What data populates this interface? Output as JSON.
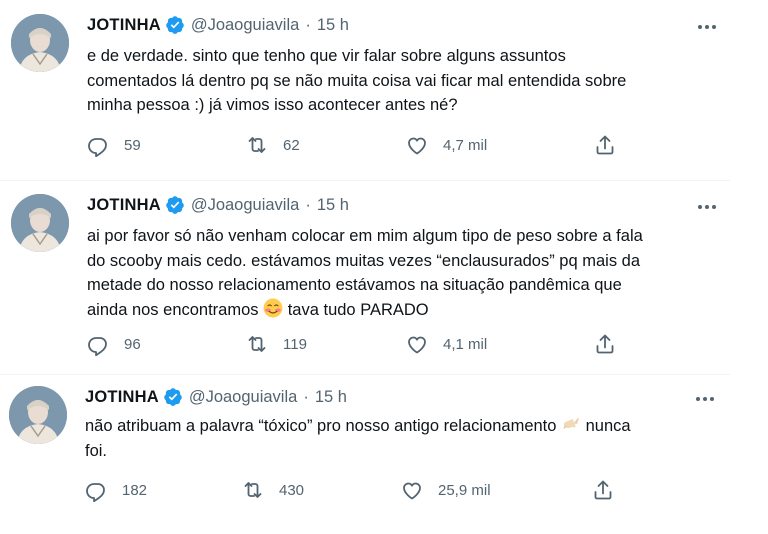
{
  "tweets": [
    {
      "author": {
        "name": "JOTINHA",
        "handle": "@Joaoguiavila",
        "time": "15 h",
        "avatar_icon": "profile-photo"
      },
      "lines": [
        "e de verdade. sinto que tenho que vir falar sobre alguns assuntos",
        "comentados lá dentro pq se não muita coisa vai ficar mal entendida sobre",
        "minha pessoa :) já vimos isso acontecer antes né?"
      ],
      "stats": {
        "replies": "59",
        "retweets": "62",
        "likes": "4,7 mil"
      }
    },
    {
      "author": {
        "name": "JOTINHA",
        "handle": "@Joaoguiavila",
        "time": "15 h",
        "avatar_icon": "profile-photo"
      },
      "lines": [
        "ai por favor só não venham colocar em mim algum tipo de peso sobre a fala",
        "do scooby mais cedo. estávamos muitas vezes “enclausurados” pq mais da",
        "metade do nosso relacionamento estávamos na situação pandêmica que",
        "ainda nos encontramos",
        "tava tudo PARADO"
      ],
      "emoji": "smiling-face-with-blush",
      "stats": {
        "replies": "96",
        "retweets": "119",
        "likes": "4,1 mil"
      }
    },
    {
      "author": {
        "name": "JOTINHA",
        "handle": "@Joaoguiavila",
        "time": "15 h",
        "avatar_icon": "profile-photo"
      },
      "lines": [
        "não atribuam a palavra “tóxico” pro nosso antigo relacionamento",
        "nunca",
        "foi."
      ],
      "emoji": "call-me-hand",
      "stats": {
        "replies": "182",
        "retweets": "430",
        "likes": "25,9 mil"
      }
    }
  ],
  "colors": {
    "text": "#0f1419",
    "secondary": "#536471",
    "verified": "#1d9bf0",
    "divider": "#eff3f4"
  },
  "icons": [
    "verified-badge-icon",
    "more-icon",
    "reply-icon",
    "retweet-icon",
    "like-icon",
    "share-icon"
  ]
}
